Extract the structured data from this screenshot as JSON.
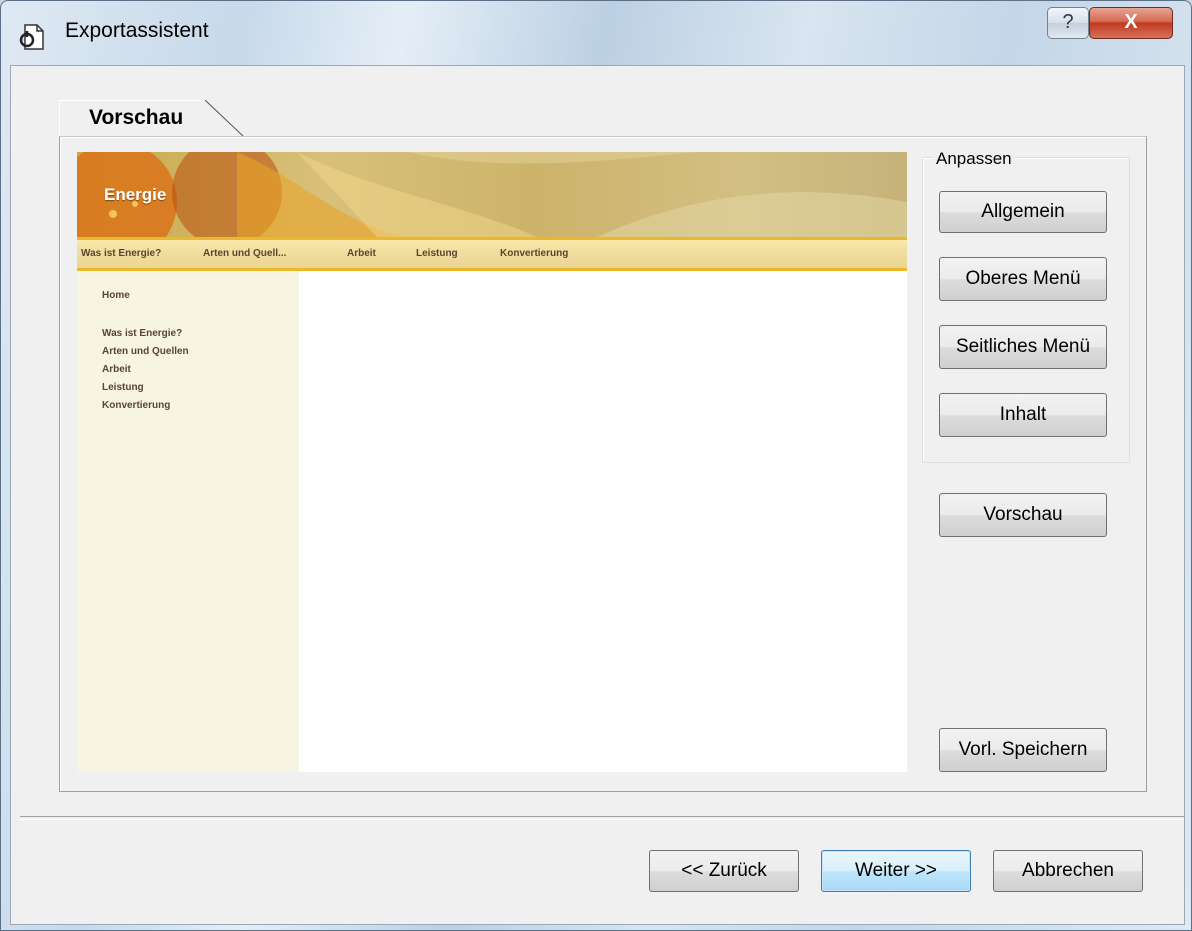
{
  "window": {
    "title": "Exportassistent",
    "help_label": "?",
    "close_label": "X"
  },
  "tab": {
    "label": "Vorschau"
  },
  "preview": {
    "site_title": "Energie",
    "top_nav": [
      "Was ist Energie?",
      "Arten und Quell...",
      "Arbeit",
      "Leistung",
      "Konvertierung"
    ],
    "side_nav": {
      "home": "Home",
      "items": [
        "Was ist Energie?",
        "Arten und Quellen",
        "Arbeit",
        "Leistung",
        "Konvertierung"
      ]
    }
  },
  "customize": {
    "group_title": "Anpassen",
    "general": "Allgemein",
    "top_menu": "Oberes Menü",
    "side_menu": "Seitliches Menü",
    "content": "Inhalt"
  },
  "preview_button": "Vorschau",
  "save_template_button": "Vorl. Speichern",
  "footer": {
    "back": "<< Zurück",
    "next": "Weiter >>",
    "cancel": "Abbrechen"
  }
}
